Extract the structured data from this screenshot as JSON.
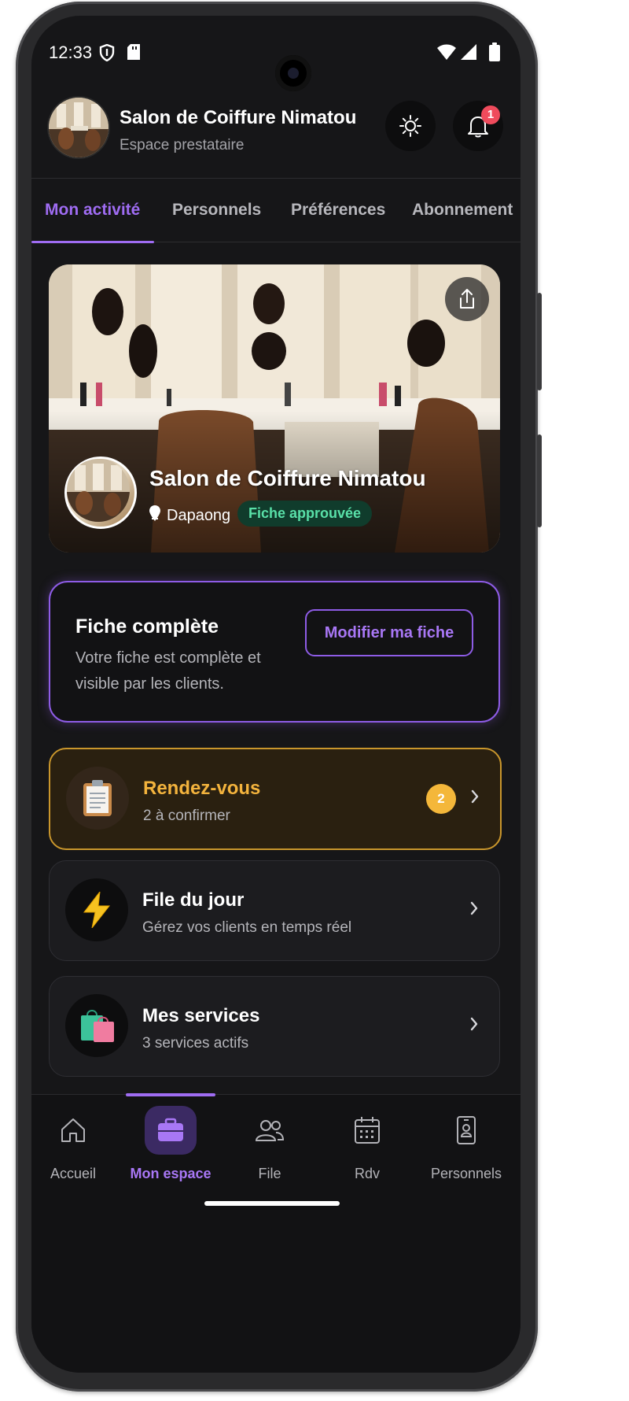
{
  "status_bar": {
    "time": "12:33"
  },
  "header": {
    "title": "Salon de Coiffure Nimatou",
    "subtitle": "Espace prestataire",
    "notification_count": "1"
  },
  "tabs": [
    {
      "label": "Mon activité",
      "active": true
    },
    {
      "label": "Personnels"
    },
    {
      "label": "Préférences"
    },
    {
      "label": "Abonnement"
    }
  ],
  "hero": {
    "title": "Salon de Coiffure Nimatou",
    "location": "Dapaong",
    "status_badge": "Fiche approuvée"
  },
  "fiche": {
    "title": "Fiche complète",
    "description": "Votre fiche est complète et visible par les clients.",
    "button_label": "Modifier ma fiche"
  },
  "cards": [
    {
      "title": "Rendez-vous",
      "subtitle": "2 à confirmer",
      "count": "2",
      "icon": "clipboard-icon"
    },
    {
      "title": "File du jour",
      "subtitle": "Gérez vos clients en temps réel",
      "icon": "lightning-icon"
    },
    {
      "title": "Mes services",
      "subtitle": "3 services actifs",
      "icon": "shopping-bags-icon"
    }
  ],
  "bottom_nav": [
    {
      "label": "Accueil",
      "icon": "home-icon"
    },
    {
      "label": "Mon espace",
      "icon": "briefcase-icon",
      "active": true
    },
    {
      "label": "File",
      "icon": "users-icon"
    },
    {
      "label": "Rdv",
      "icon": "calendar-icon"
    },
    {
      "label": "Personnels",
      "icon": "phone-badge-icon"
    }
  ],
  "colors": {
    "accent": "#9f6cf2",
    "warning": "#f3b33d",
    "success": "#59e0a8",
    "badge_red": "#ef4b5c",
    "background": "#161618"
  }
}
